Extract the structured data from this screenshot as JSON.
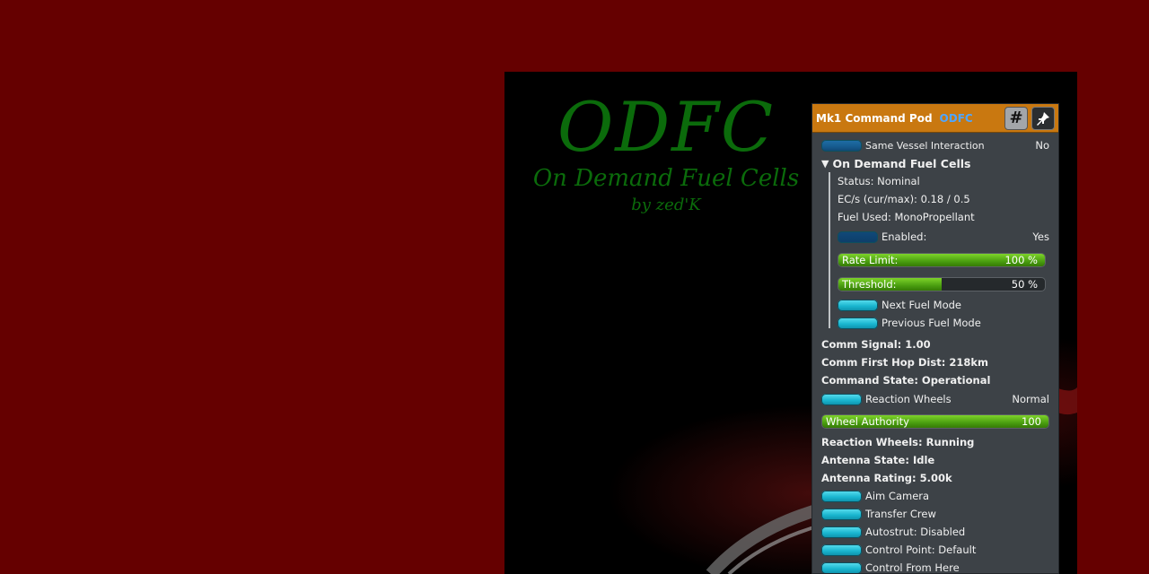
{
  "logo": {
    "title": "ODFC",
    "subtitle": "On Demand Fuel Cells",
    "byline": "by zed'K"
  },
  "pane": {
    "title": "Mk1 Command Pod",
    "subtitle": "ODFC",
    "hash_label": "#",
    "pin_icon": "pin-icon",
    "same_vessel": {
      "label": "Same Vessel Interaction",
      "value": "No"
    },
    "section": {
      "title": "On Demand Fuel Cells",
      "status": "Status: Nominal",
      "ec": "EC/s (cur/max): 0.18 / 0.5",
      "fuel_used": "Fuel Used: MonoPropellant",
      "enabled": {
        "label": "Enabled:",
        "value": "Yes"
      },
      "rate_limit": {
        "label": "Rate Limit:",
        "value": "100 %",
        "fraction": 1.0
      },
      "threshold": {
        "label": "Threshold:",
        "value": "50 %",
        "fraction": 0.5
      },
      "next_fuel": "Next Fuel Mode",
      "prev_fuel": "Previous Fuel Mode"
    },
    "comm_signal": "Comm Signal: 1.00",
    "comm_hop": "Comm First Hop Dist: 218km",
    "command_state": "Command State: Operational",
    "reaction_wheels": {
      "label": "Reaction Wheels",
      "value": "Normal"
    },
    "wheel_authority": {
      "label": "Wheel Authority",
      "value": "100",
      "fraction": 1.0
    },
    "rw_status": "Reaction Wheels: Running",
    "antenna_state": "Antenna State: Idle",
    "antenna_rating": "Antenna Rating: 5.00k",
    "aim_camera": "Aim Camera",
    "transfer_crew": "Transfer Crew",
    "autostrut": "Autostrut: Disabled",
    "control_point": "Control Point: Default",
    "control_from_here": "Control From Here"
  },
  "colors": {
    "page_bg": "#650000",
    "logo_green": "#0b6b0b",
    "header_orange": "#c97810",
    "button_cyan": "#1ab6d0",
    "slider_green": "#4a9e10"
  }
}
